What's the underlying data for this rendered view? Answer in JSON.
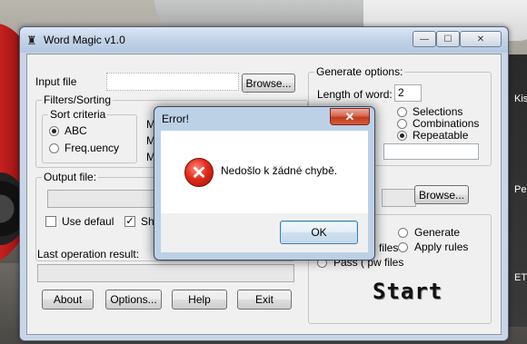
{
  "desktop": {
    "side_labels": [
      "Kis",
      "Pe",
      "ETN"
    ]
  },
  "main_window": {
    "title": "Word Magic v1.0",
    "controls": {
      "minimize": "—",
      "maximize": "☐",
      "close": "✕"
    },
    "input_file": {
      "label": "Input file",
      "value": "",
      "browse": "Browse..."
    },
    "filters": {
      "legend": "Filters/Sorting",
      "sort_criteria": {
        "legend": "Sort criteria",
        "options": [
          "ABC",
          "Freq.uency"
        ],
        "selected": "ABC"
      },
      "clipped": [
        "M",
        "M",
        "M"
      ]
    },
    "output": {
      "legend": "Output  file:",
      "value": "",
      "browse": "Browse...",
      "use_default": "Use defaul",
      "show_clipped": "Sho"
    },
    "last_result": {
      "label": "Last operation result:",
      "value": ""
    },
    "buttons": {
      "about": "About",
      "options": "Options...",
      "help": "Help",
      "exit": "Exit"
    },
    "generate_options": {
      "legend": "Generate options:",
      "length_label": "Length of word:",
      "length_value": "2",
      "modes": [
        "Selections",
        "Combinations",
        "Repeatable"
      ],
      "selected_mode": "Repeatable"
    },
    "action": {
      "files_suffix": "files",
      "pass_label": "Pass ( pw files",
      "choices": [
        "Generate",
        "Apply rules"
      ],
      "start": "Start"
    }
  },
  "error_dialog": {
    "title": "Error!",
    "close": "✕",
    "icon": "error-icon",
    "message": "Nedošlo k žádné chybě.",
    "ok": "OK"
  },
  "colors": {
    "title_bar": "#c2d3e8",
    "close_red": "#c23a1f",
    "error_icon": "#e02b1a"
  }
}
